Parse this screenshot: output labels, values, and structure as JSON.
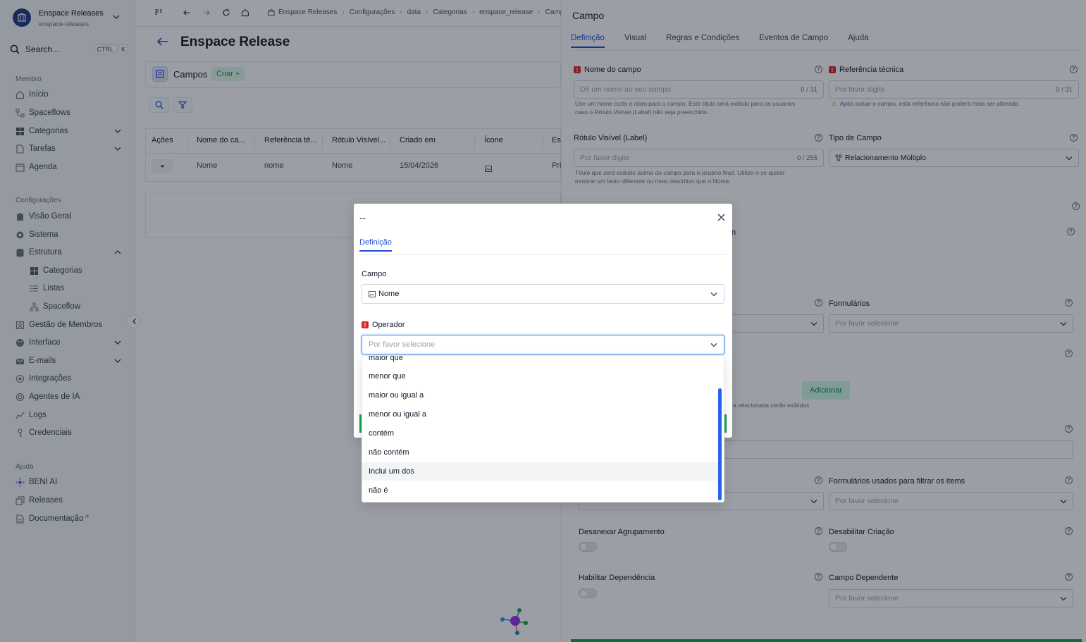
{
  "workspace": {
    "name": "Enspace Releases",
    "slug": "enspace-releases"
  },
  "search": {
    "label": "Search...",
    "shortcut_key1": "CTRL",
    "shortcut_key2": "K"
  },
  "sidebar": {
    "section_member": "Membro",
    "member_items": [
      {
        "label": "Início",
        "icon": "home-icon"
      },
      {
        "label": "Spaceflows",
        "icon": "flow-icon"
      },
      {
        "label": "Categorias",
        "icon": "grid-icon"
      },
      {
        "label": "Tarefas",
        "icon": "file-icon"
      },
      {
        "label": "Agenda",
        "icon": "calendar-icon"
      }
    ],
    "section_config": "Configurações",
    "config_items": [
      {
        "label": "Visão Geral",
        "icon": "building-icon"
      },
      {
        "label": "Sistema",
        "icon": "gear-icon"
      },
      {
        "label": "Estrutura",
        "icon": "database-icon"
      },
      {
        "label": "Categorias",
        "icon": "grid-icon"
      },
      {
        "label": "Listas",
        "icon": "list-icon"
      },
      {
        "label": "Spaceflow",
        "icon": "flow-icon"
      },
      {
        "label": "Gestão de Membros",
        "icon": "users-icon"
      },
      {
        "label": "Interface",
        "icon": "palette-icon"
      },
      {
        "label": "E-mails",
        "icon": "mail-icon"
      },
      {
        "label": "Integrações",
        "icon": "plug-icon"
      },
      {
        "label": "Agentes de IA",
        "icon": "bot-icon"
      },
      {
        "label": "Logs",
        "icon": "chart-icon"
      },
      {
        "label": "Credenciais",
        "icon": "key-icon"
      }
    ],
    "section_help": "Ajuda",
    "help_items": [
      {
        "label": "BENI AI",
        "icon": "ai-icon"
      },
      {
        "label": "Releases",
        "icon": "copy-icon"
      },
      {
        "label": "Documentação",
        "icon": "doc-icon"
      }
    ]
  },
  "breadcrumb": [
    "Enspace Releases",
    "Configurações",
    "data",
    "Categorias",
    "enspace_release",
    "Campo"
  ],
  "main": {
    "title": "Enspace Release",
    "section_title": "Campos",
    "create_label": "Criar +",
    "table": {
      "headers": [
        "Ações",
        "Nome do ca...",
        "Referência té...",
        "Rótulo Visível...",
        "Criado em",
        "Ícone",
        "Es"
      ],
      "rows": [
        {
          "nome": "Nome",
          "referencia": "nome",
          "rotulo": "Nome",
          "criado": "15/04/2026",
          "status": "Pri"
        }
      ]
    }
  },
  "panel": {
    "title": "Campo",
    "tabs": [
      "Definição",
      "Visual",
      "Regras e Condições",
      "Eventos de Campo",
      "Ajuda"
    ],
    "nome_campo": {
      "label": "Nome do campo",
      "placeholder": "Dê um nome ao seu campo",
      "count": "0 / 31",
      "help1": "Use um nome curto e claro para o campo. Este título será exibido para os usuários",
      "help2": "caso o Rótulo Visível (Label) não seja preenchido."
    },
    "ref_tecnica": {
      "label": "Referência técnica",
      "placeholder": "Por favor digite",
      "count": "0 / 31",
      "help": "Após salvar o campo, esta referência não poderá mais ser alterada."
    },
    "rotulo": {
      "label": "Rótulo Visível (Label)",
      "placeholder": "Por favor digite",
      "count": "0 / 255",
      "help1": "Título que será exibido acima do campo para o usuário final. Utilize-o se quiser",
      "help2": "mostrar um texto diferente ou mais descritivo que o Nome."
    },
    "tipo": {
      "label": "Tipo de Campo",
      "value": "Relacionamento Múltiplo"
    },
    "partial_n": "n",
    "formularios": {
      "label": "Formulários",
      "placeholder": "Por favor selecione"
    },
    "adicionar": "Adicionar",
    "relacionada_text": "a relacionada serão exibidos",
    "formularios_filtrar": {
      "label": "Formulários usados para filtrar os items",
      "placeholder": "Por favor selecione"
    },
    "desanexar": "Desanexar Agrupamento",
    "desabilitar": "Desabilitar Criação",
    "habilitar_dep": "Habilitar Dependência",
    "campo_dep": {
      "label": "Campo Dependente",
      "placeholder": "Por favor selecione"
    }
  },
  "modal": {
    "title": "--",
    "tab": "Definição",
    "campo_label": "Campo",
    "campo_value": "Nome",
    "operador_label": "Operador",
    "operador_placeholder": "Por favor selecione",
    "options": [
      "maior que",
      "menor que",
      "maior ou igual a",
      "menor ou igual a",
      "contém",
      "não contém",
      "Inclui um dos",
      "não é"
    ],
    "hovered_option": "Inclui um dos"
  },
  "colors": {
    "accent": "#1d4ed8",
    "required": "#dc2626",
    "success": "#16a34a"
  }
}
